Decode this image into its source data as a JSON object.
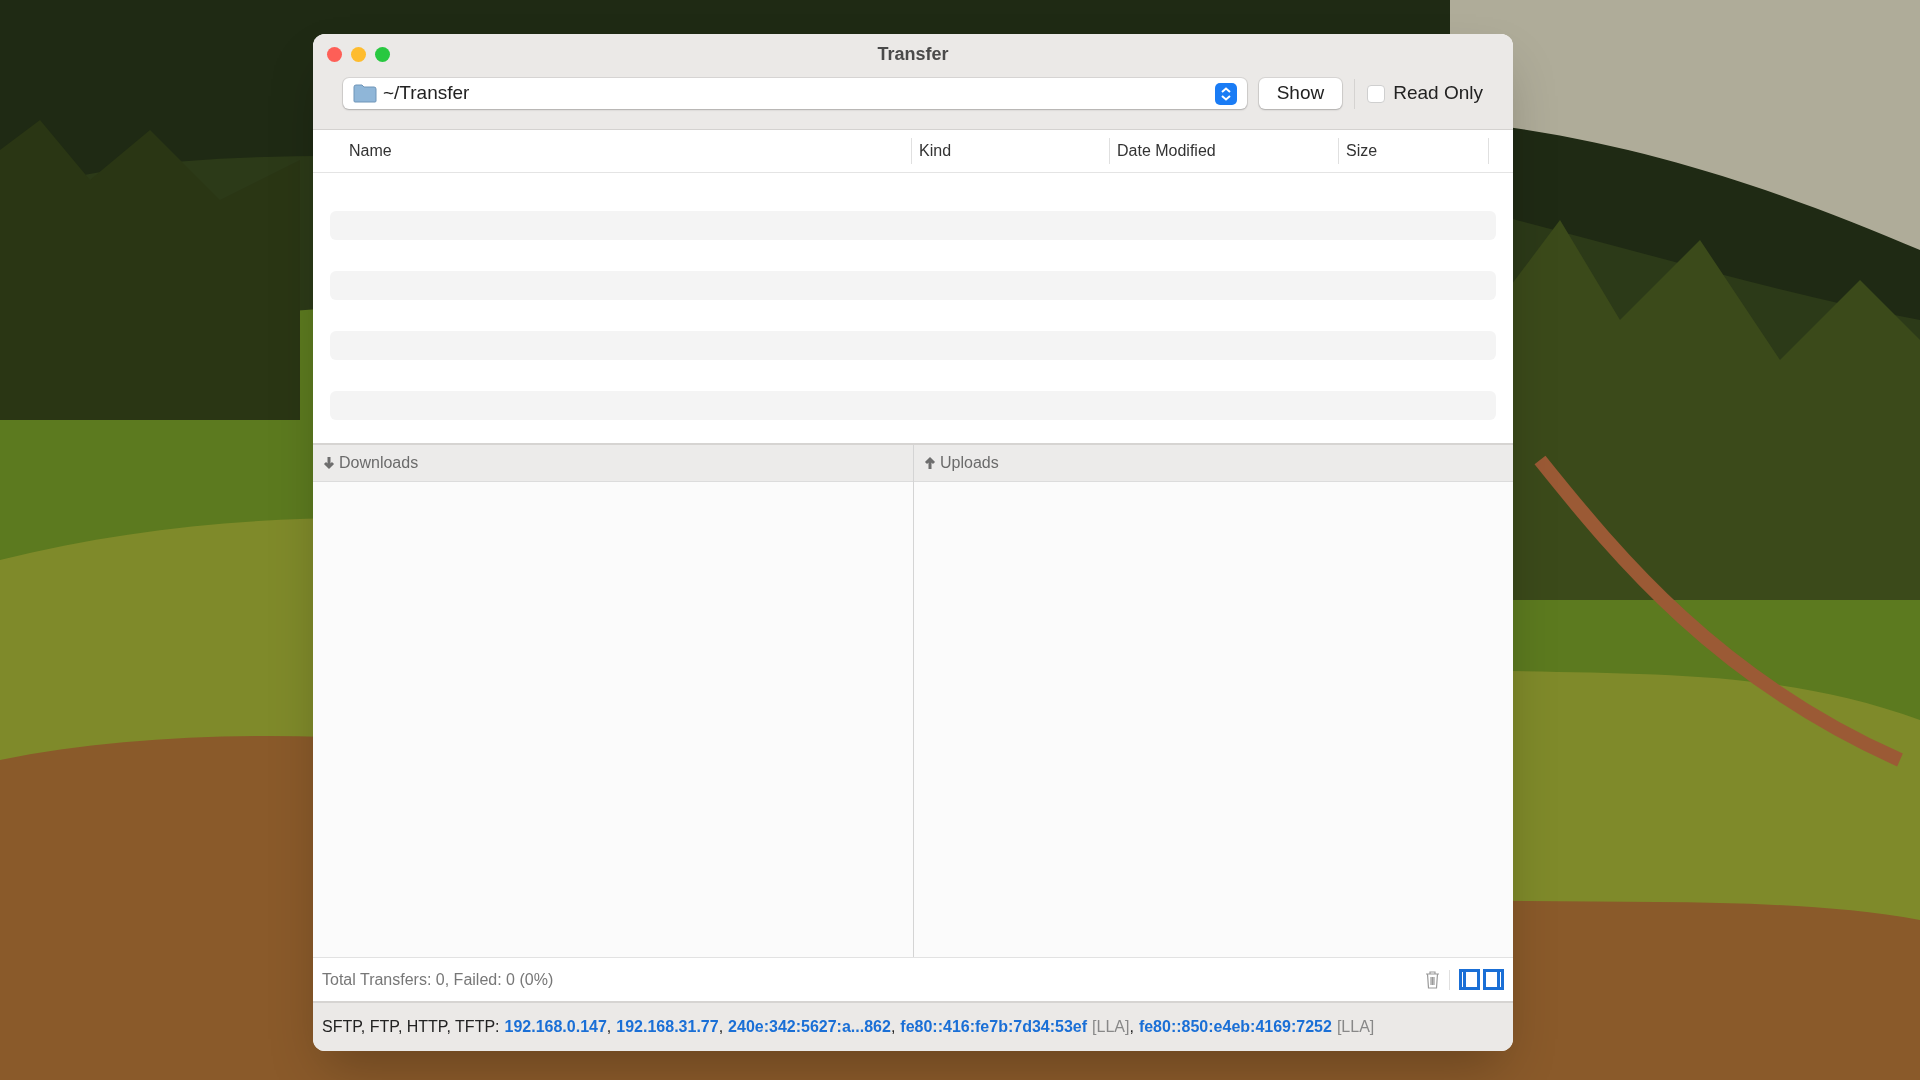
{
  "window": {
    "title": "Transfer"
  },
  "toolbar": {
    "folder_path": "~/Transfer",
    "show_button": "Show",
    "read_only": {
      "label": "Read Only",
      "checked": false
    }
  },
  "table": {
    "columns": [
      "Name",
      "Kind",
      "Date Modified",
      "Size"
    ]
  },
  "panes": [
    {
      "kind": "download",
      "title": "Downloads"
    },
    {
      "kind": "upload",
      "title": "Uploads"
    }
  ],
  "footer": {
    "summary": "Total Transfers: 0, Failed: 0 (0%)",
    "pane_toggles": [
      {
        "selected": true
      },
      {
        "selected": true
      }
    ]
  },
  "status_bar": {
    "prefix": "SFTP, FTP, HTTP, TFTP:",
    "addresses": [
      {
        "address": "192.168.0.147",
        "separator": ","
      },
      {
        "address": "192.168.31.77",
        "separator": ","
      },
      {
        "address": "240e:342:5627:a...862",
        "separator": ","
      },
      {
        "address": "fe80::416:fe7b:7d34:53ef",
        "tag": "[LLA]",
        "separator": ","
      },
      {
        "address": "fe80::850:e4eb:4169:7252",
        "tag": "[LLA]"
      }
    ]
  }
}
